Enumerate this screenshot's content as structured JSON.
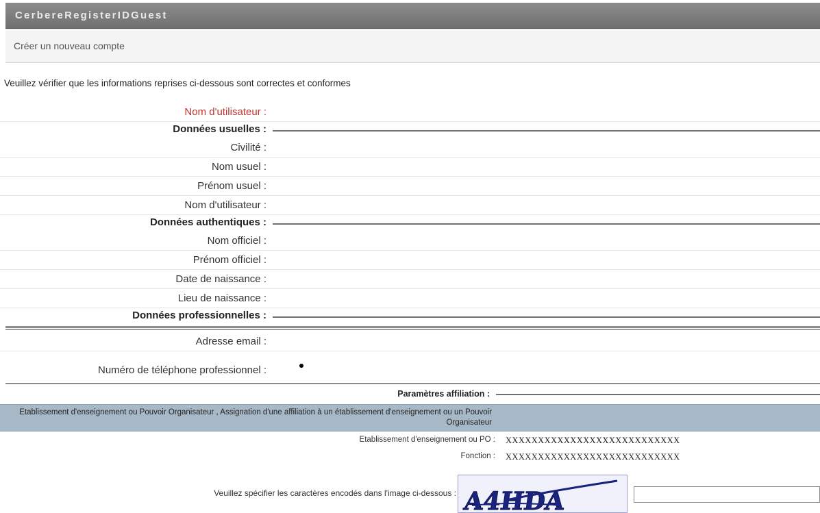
{
  "window": {
    "title": "CerbereRegisterIDGuest"
  },
  "header": {
    "subtitle": "Créer un nouveau compte"
  },
  "intro": "Veuillez vérifier que les informations reprises ci-dessous sont correctes et conformes",
  "username_field": {
    "label": "Nom d'utilisateur :"
  },
  "section_usual": {
    "title": "Données usuelles :"
  },
  "usual_fields": {
    "civilite": "Civilité :",
    "nom_usuel": "Nom usuel :",
    "prenom_usuel": "Prénom usuel :",
    "nom_utilisateur": "Nom d'utilisateur :"
  },
  "section_auth": {
    "title": "Données authentiques :"
  },
  "auth_fields": {
    "nom_officiel": "Nom officiel :",
    "prenom_officiel": "Prénom officiel :",
    "date_naissance": "Date de naissance :",
    "lieu_naissance": "Lieu de naissance :"
  },
  "section_pro": {
    "title": "Données professionnelles :"
  },
  "pro_fields": {
    "email": "Adresse email :",
    "telephone": "Numéro de téléphone professionnel :"
  },
  "section_affiliation": {
    "title": "Paramètres affiliation :"
  },
  "affiliation_bar": {
    "text": "Etablissement d'enseignement ou Pouvoir Organisateur , Assignation d'une affiliation à un établissement d'enseignement ou un Pouvoir Organisateur"
  },
  "affiliation": {
    "etablissement_label": "Etablissement d'enseignement ou PO :",
    "etablissement_value": "XXXXXXXXXXXXXXXXXXXXXXXXXXX",
    "fonction_label": "Fonction :",
    "fonction_value": "XXXXXXXXXXXXXXXXXXXXXXXXXXX"
  },
  "captcha": {
    "label": "Veuillez spécifier les caractères encodés dans l'image ci-dessous :",
    "image_text": "A4HDA",
    "input_value": ""
  }
}
